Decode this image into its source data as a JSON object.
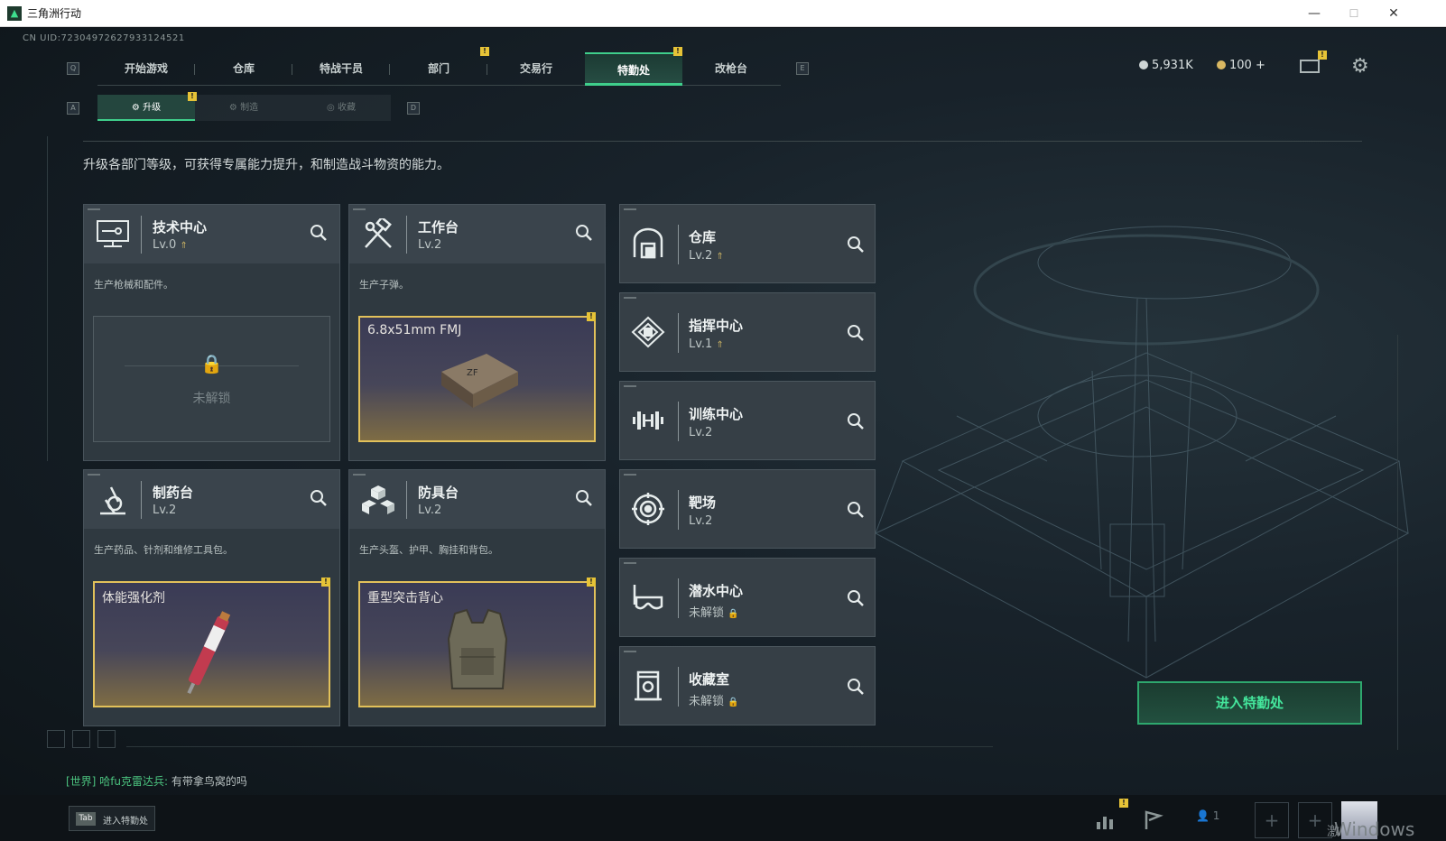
{
  "window": {
    "title": "三角洲行动",
    "controls": [
      "—",
      "☐",
      "✕"
    ]
  },
  "uid": "CN UID:72304972627933124521",
  "nav": {
    "left_key": "Q",
    "right_key": "E",
    "tabs": [
      "开始游戏",
      "仓库",
      "特战干员",
      "部门",
      "交易行",
      "特勤处",
      "改枪台"
    ],
    "active": "特勤处"
  },
  "resources": {
    "currency1": "5,931K",
    "currency2": "100 +"
  },
  "subnav": {
    "left_key": "A",
    "right_key": "D",
    "tabs": [
      "升级",
      "制造",
      "收藏"
    ],
    "active": "升级"
  },
  "description": "升级各部门等级，可获得专属能力提升，和制造战斗物资的能力。",
  "cards": [
    {
      "name": "技术中心",
      "level": "Lv.0",
      "icon": "monitor-icon",
      "text": "生产枪械和配件。",
      "locked_label": "未解锁",
      "slot": "locked"
    },
    {
      "name": "工作台",
      "level": "Lv.2",
      "icon": "hammer-wrench-icon",
      "text": "生产子弹。",
      "slot_title": "6.8x51mm FMJ",
      "slot": "ammo"
    },
    {
      "name": "制药台",
      "level": "Lv.2",
      "icon": "microscope-icon",
      "text": "生产药品、针剂和维修工具包。",
      "slot_title": "体能强化剂",
      "slot": "syringe"
    },
    {
      "name": "防具台",
      "level": "Lv.2",
      "icon": "cubes-icon",
      "text": "生产头盔、护甲、胸挂和背包。",
      "slot_title": "重型突击背心",
      "slot": "vest"
    }
  ],
  "facilities": [
    {
      "name": "仓库",
      "level": "Lv.2",
      "icon": "warehouse-icon",
      "upgrade": true
    },
    {
      "name": "指挥中心",
      "level": "Lv.1",
      "icon": "command-icon",
      "upgrade": true
    },
    {
      "name": "训练中心",
      "level": "Lv.2",
      "icon": "dumbbell-icon",
      "upgrade": false
    },
    {
      "name": "靶场",
      "level": "Lv.2",
      "icon": "target-icon",
      "upgrade": false
    },
    {
      "name": "潜水中心",
      "level": "未解锁",
      "icon": "diving-mask-icon",
      "locked": true
    },
    {
      "name": "收藏室",
      "level": "未解锁",
      "icon": "trophy-case-icon",
      "locked": true
    }
  ],
  "enter_button": "进入特勤处",
  "chat": {
    "channel": "[世界]",
    "user": "哈fu克雷达兵:",
    "message": "有带拿鸟窝的吗"
  },
  "bottom": {
    "tab_key": "Tab",
    "tab_label": "进入特勤处",
    "team_count": "1",
    "watermark": "Windows",
    "watermark_prefix": "激"
  },
  "colors": {
    "accent": "#3fce8b",
    "badge": "#e6c337",
    "slot_border": "#e2c15a"
  }
}
